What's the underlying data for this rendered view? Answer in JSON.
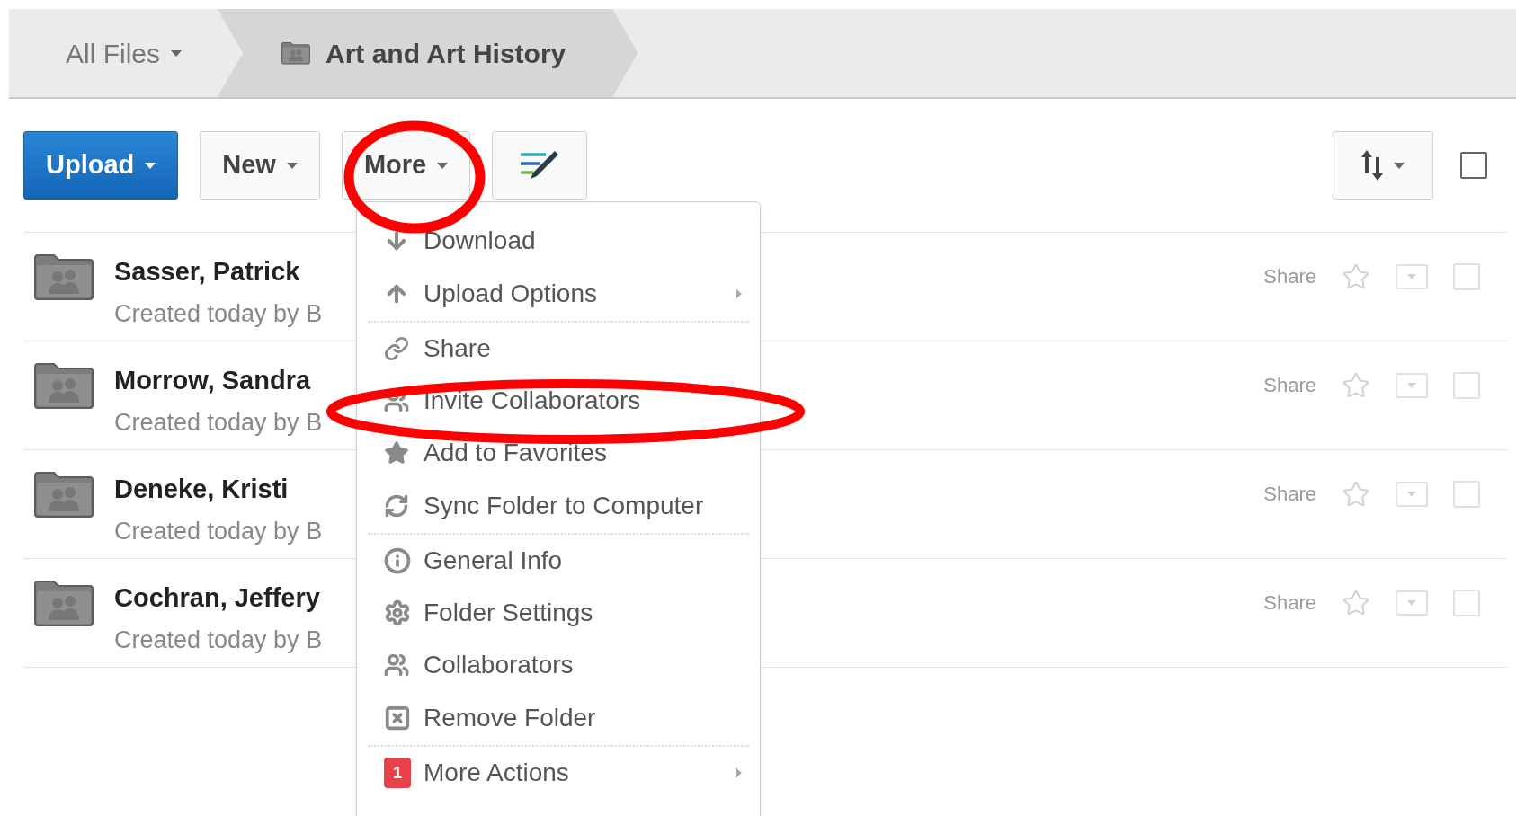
{
  "breadcrumbs": [
    {
      "label": "All Files",
      "current": false
    },
    {
      "label": "Art and Art History",
      "current": true
    }
  ],
  "toolbar": [
    {
      "kind": "primary",
      "label": "Upload"
    },
    {
      "kind": "plain",
      "label": "New"
    },
    {
      "kind": "plain",
      "label": "More"
    },
    {
      "kind": "edit"
    }
  ],
  "select_all": {
    "checked": false
  },
  "rows": [
    {
      "name": "Sasser, Patrick",
      "subtitle": "Created today by B",
      "share": "Share",
      "checked": false
    },
    {
      "name": "Morrow, Sandra",
      "subtitle": "Created today by B",
      "share": "Share",
      "checked": false
    },
    {
      "name": "Deneke, Kristi",
      "subtitle": "Created today by B",
      "share": "Share",
      "checked": false
    },
    {
      "name": "Cochran, Jeffery",
      "subtitle": "Created today by B",
      "share": "Share",
      "checked": false
    }
  ],
  "menu": [
    {
      "label": "Download",
      "kind": "download",
      "submenu": false,
      "separator_after": false
    },
    {
      "label": "Upload Options",
      "kind": "upload",
      "submenu": true,
      "separator_after": true
    },
    {
      "label": "Share",
      "kind": "link",
      "submenu": false,
      "separator_after": false
    },
    {
      "label": "Invite Collaborators",
      "kind": "people",
      "submenu": false,
      "separator_after": false
    },
    {
      "label": "Add to Favorites",
      "kind": "star",
      "submenu": false,
      "separator_after": false
    },
    {
      "label": "Sync Folder to Computer",
      "kind": "sync",
      "submenu": false,
      "separator_after": true
    },
    {
      "label": "General Info",
      "kind": "info",
      "submenu": false,
      "separator_after": false
    },
    {
      "label": "Folder Settings",
      "kind": "gear",
      "submenu": false,
      "separator_after": false
    },
    {
      "label": "Collaborators",
      "kind": "people",
      "submenu": false,
      "separator_after": false
    },
    {
      "label": "Remove Folder",
      "kind": "remove",
      "submenu": false,
      "separator_after": true
    },
    {
      "label": "More Actions",
      "kind": "badge",
      "badge": "1",
      "submenu": true,
      "separator_after": false
    }
  ]
}
